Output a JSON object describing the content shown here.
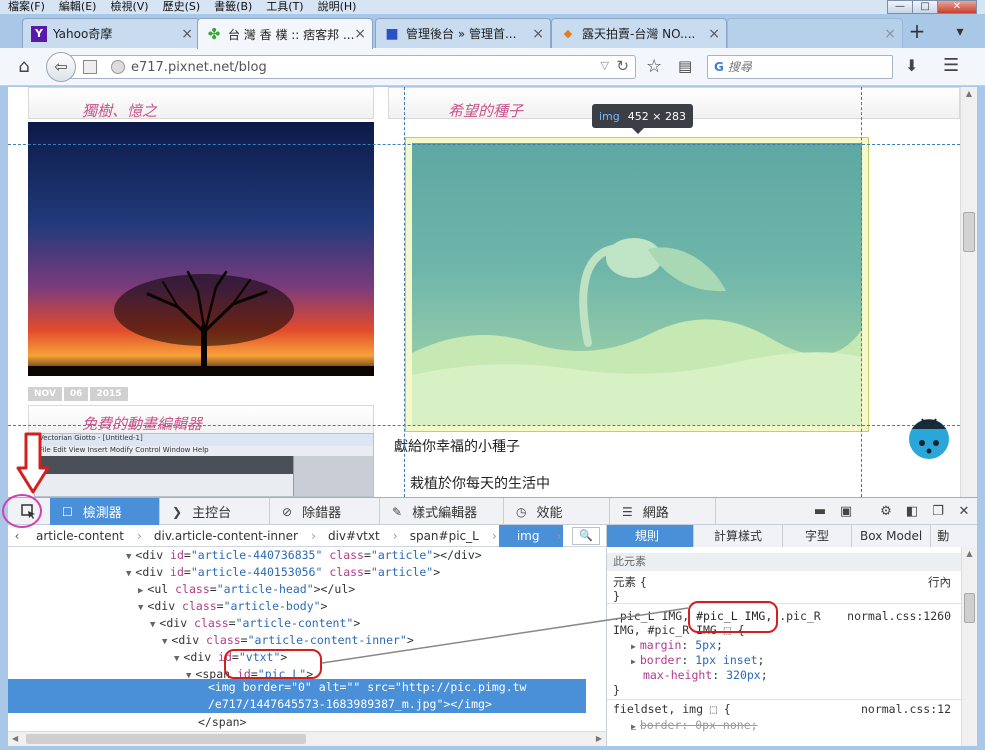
{
  "menu": [
    "檔案(F)",
    "編輯(E)",
    "檢視(V)",
    "歷史(S)",
    "書籤(B)",
    "工具(T)",
    "說明(H)"
  ],
  "window_controls": {
    "minimize": "—",
    "maximize": "□",
    "close": "✕"
  },
  "tabs": [
    {
      "label": "Yahoo奇摩",
      "icon": "Y",
      "icon_color": "#5a1aa8"
    },
    {
      "label": "台 灣 香 樸 :: 痞客邦 ...",
      "icon": "✤",
      "icon_color": "#3aa535",
      "active": true
    },
    {
      "label": "管理後台 » 管理首...",
      "icon": "■",
      "icon_color": "#2b50c8"
    },
    {
      "label": "露天拍賣-台灣 NO....",
      "icon": "◆",
      "icon_color": "#e07d20"
    }
  ],
  "new_tab_label": "+",
  "url": "e717.pixnet.net/blog",
  "search_placeholder": "搜尋",
  "page": {
    "left_post_1_title": "獨樹、憶之",
    "date": [
      "NOV",
      "06",
      "2015"
    ],
    "left_post_2_title": "免費的動畫編輯器",
    "editor_title": "Vectorian Giotto - [Untitled-1]",
    "editor_menu": "File  Edit  View  Insert  Modify  Control  Window  Help",
    "right_post_title": "希望的種子",
    "tooltip_tag": "img",
    "tooltip_size": "452 × 283",
    "text_line_1": "獻給你幸福的小種子",
    "text_line_2": "栽植於你每天的生活中"
  },
  "devtools": {
    "tabs": [
      {
        "label": "檢測器",
        "icon": "☐",
        "active": true
      },
      {
        "label": "主控台",
        "icon": "❯"
      },
      {
        "label": "除錯器",
        "icon": "⊘"
      },
      {
        "label": "樣式編輯器",
        "icon": "✎"
      },
      {
        "label": "效能",
        "icon": "◷"
      },
      {
        "label": "網路",
        "icon": "☰"
      }
    ],
    "breadcrumbs": [
      "article-content",
      "div.article-content-inner",
      "div#vtxt",
      "span#pic_L",
      "img"
    ],
    "markup": [
      {
        "indent": 0,
        "tw": "▼",
        "open": "<div ",
        "attrs": [
          [
            "id",
            "\"article-440736835\""
          ],
          [
            "class",
            "\"article\""
          ]
        ],
        "close": "></div>"
      },
      {
        "indent": 0,
        "tw": "▼",
        "open": "<div ",
        "attrs": [
          [
            "id",
            "\"article-440153056\""
          ],
          [
            "class",
            "\"article\""
          ]
        ],
        "close": ">"
      },
      {
        "indent": 1,
        "tw": "▶",
        "open": "<ul ",
        "attrs": [
          [
            "class",
            "\"article-head\""
          ]
        ],
        "close": "></ul>"
      },
      {
        "indent": 1,
        "tw": "▼",
        "open": "<div ",
        "attrs": [
          [
            "class",
            "\"article-body\""
          ]
        ],
        "close": ">"
      },
      {
        "indent": 2,
        "tw": "▼",
        "open": "<div ",
        "attrs": [
          [
            "class",
            "\"article-content\""
          ]
        ],
        "close": ">"
      },
      {
        "indent": 3,
        "tw": "▼",
        "open": "<div ",
        "attrs": [
          [
            "class",
            "\"article-content-inner\""
          ]
        ],
        "close": ">"
      },
      {
        "indent": 4,
        "tw": "▼",
        "open": "<div ",
        "attrs": [
          [
            "id",
            "\"vtxt\""
          ]
        ],
        "close": ">"
      },
      {
        "indent": 5,
        "tw": "▼",
        "open": "<span ",
        "attrs": [
          [
            "id",
            "\"pic_L\""
          ]
        ],
        "close": ">"
      }
    ],
    "selected_line_1": "<img border=\"0\" alt=\"\" src=\"http://pic.pimg.tw",
    "selected_line_2": "/e717/1447645573-1683989387_m.jpg\"></img>",
    "after_line": "</span>",
    "rule_tabs": [
      "規則",
      "計算樣式",
      "字型",
      "Box Model",
      "動"
    ],
    "rules": {
      "section_this": "此元素",
      "element_rule": "元素 {",
      "element_inline": "行內",
      "brace_close": "}",
      "rule1_selector_a": ".pic_L IMG, ",
      "rule1_selector_hl": "#pic_L IMG,",
      "rule1_selector_b": " .pic_R",
      "rule1_selector_c": "IMG, #pic_R IMG ⬚ {",
      "rule1_source": "normal.css:1260",
      "rule1_props": [
        [
          "margin",
          "5px"
        ],
        [
          "border",
          "1px inset"
        ],
        [
          "max-height",
          "320px"
        ]
      ],
      "rule2_selector": "fieldset, img ⬚ {",
      "rule2_source": "normal.css:12",
      "rule2_prop": [
        "border",
        "0px none"
      ]
    }
  }
}
